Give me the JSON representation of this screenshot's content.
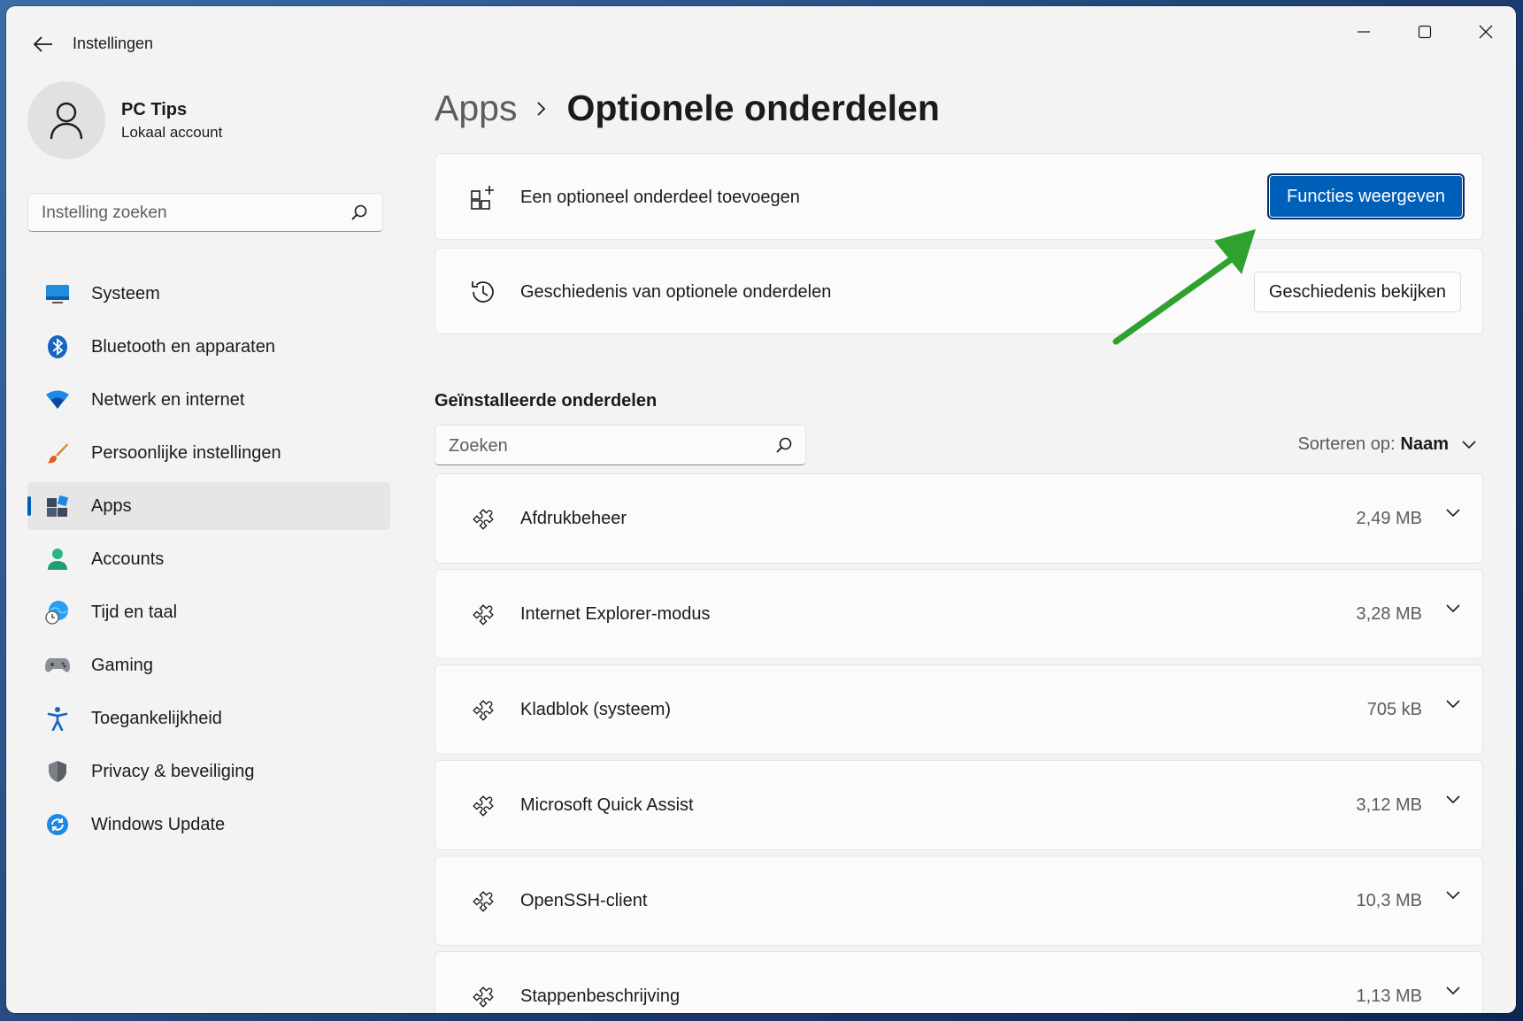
{
  "window": {
    "title": "Instellingen"
  },
  "profile": {
    "name": "PC Tips",
    "account_type": "Lokaal account"
  },
  "sidebar": {
    "search_placeholder": "Instelling zoeken",
    "items": [
      {
        "label": "Systeem",
        "icon": "monitor-icon"
      },
      {
        "label": "Bluetooth en apparaten",
        "icon": "bluetooth-icon"
      },
      {
        "label": "Netwerk en internet",
        "icon": "wifi-icon"
      },
      {
        "label": "Persoonlijke instellingen",
        "icon": "brush-icon"
      },
      {
        "label": "Apps",
        "icon": "apps-icon",
        "selected": true
      },
      {
        "label": "Accounts",
        "icon": "person-icon"
      },
      {
        "label": "Tijd en taal",
        "icon": "globe-clock-icon"
      },
      {
        "label": "Gaming",
        "icon": "gamepad-icon"
      },
      {
        "label": "Toegankelijkheid",
        "icon": "accessibility-icon"
      },
      {
        "label": "Privacy & beveiliging",
        "icon": "shield-icon"
      },
      {
        "label": "Windows Update",
        "icon": "update-icon"
      }
    ]
  },
  "breadcrumb": {
    "parent": "Apps",
    "current": "Optionele onderdelen"
  },
  "add_card": {
    "label": "Een optioneel onderdeel toevoegen",
    "button": "Functies weergeven"
  },
  "history_card": {
    "label": "Geschiedenis van optionele onderdelen",
    "button": "Geschiedenis bekijken"
  },
  "installed": {
    "title": "Geïnstalleerde onderdelen",
    "search_placeholder": "Zoeken",
    "sort_label": "Sorteren op:",
    "sort_value": "Naam",
    "items": [
      {
        "name": "Afdrukbeheer",
        "size": "2,49 MB"
      },
      {
        "name": "Internet Explorer-modus",
        "size": "3,28 MB"
      },
      {
        "name": "Kladblok (systeem)",
        "size": "705 kB"
      },
      {
        "name": "Microsoft Quick Assist",
        "size": "3,12 MB"
      },
      {
        "name": "OpenSSH-client",
        "size": "10,3 MB"
      },
      {
        "name": "Stappenbeschrijving",
        "size": "1,13 MB"
      }
    ]
  },
  "colors": {
    "accent": "#005fb8",
    "annotation_arrow": "#2ea12e"
  }
}
